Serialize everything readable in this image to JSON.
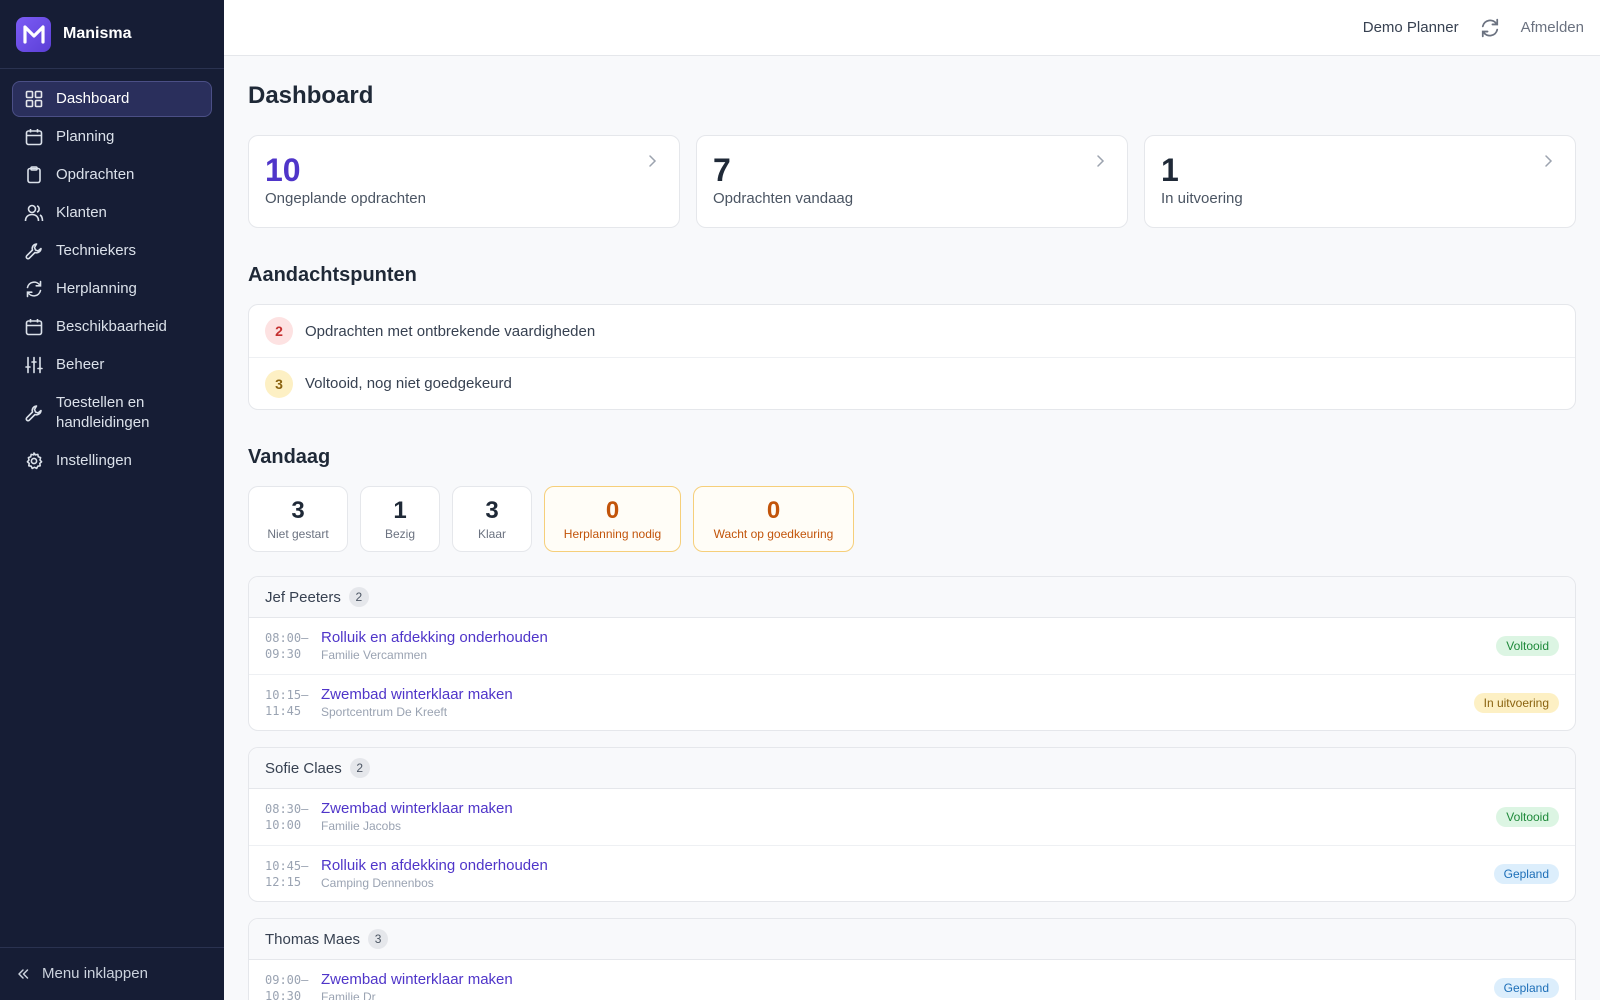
{
  "app": {
    "name": "Manisma"
  },
  "sidebar": {
    "items": [
      {
        "label": "Dashboard",
        "icon": "grid-icon",
        "active": true
      },
      {
        "label": "Planning",
        "icon": "calendar-icon"
      },
      {
        "label": "Opdrachten",
        "icon": "clipboard-icon"
      },
      {
        "label": "Klanten",
        "icon": "users-icon"
      },
      {
        "label": "Techniekers",
        "icon": "wrench-icon"
      },
      {
        "label": "Herplanning",
        "icon": "refresh-icon"
      },
      {
        "label": "Beschikbaarheid",
        "icon": "calendar-icon"
      },
      {
        "label": "Beheer",
        "icon": "sliders-icon"
      },
      {
        "label": "Toestellen en handleidingen",
        "icon": "wrench-icon"
      },
      {
        "label": "Instellingen",
        "icon": "gear-icon"
      }
    ],
    "collapse_label": "Menu inklappen"
  },
  "topbar": {
    "user": "Demo Planner",
    "logout": "Afmelden"
  },
  "page": {
    "title": "Dashboard"
  },
  "stat_cards": [
    {
      "value": "10",
      "label": "Ongeplande opdrachten"
    },
    {
      "value": "7",
      "label": "Opdrachten vandaag"
    },
    {
      "value": "1",
      "label": "In uitvoering"
    }
  ],
  "attention": {
    "title": "Aandachtspunten",
    "items": [
      {
        "count": "2",
        "label": "Opdrachten met ontbrekende vaardigheden",
        "color": "#c53030"
      },
      {
        "count": "3",
        "label": "Voltooid, nog niet goedgekeurd",
        "color": "#8a6310"
      }
    ]
  },
  "today": {
    "title": "Vandaag",
    "stats": [
      {
        "value": "3",
        "label": "Niet gestart"
      },
      {
        "value": "1",
        "label": "Bezig"
      },
      {
        "value": "3",
        "label": "Klaar"
      },
      {
        "value": "0",
        "label": "Herplanning nodig",
        "warn": true
      },
      {
        "value": "0",
        "label": "Wacht op goedkeuring",
        "warn": true
      }
    ]
  },
  "technicians": [
    {
      "name": "Jef Peeters",
      "count": "2",
      "jobs": [
        {
          "start": "08:00–",
          "end": "09:30",
          "title": "Rolluik en afdekking onderhouden",
          "client": "Familie Vercammen",
          "status": "Voltooid"
        },
        {
          "start": "10:15–",
          "end": "11:45",
          "title": "Zwembad winterklaar maken",
          "client": "Sportcentrum De Kreeft",
          "status": "In uitvoering"
        }
      ]
    },
    {
      "name": "Sofie Claes",
      "count": "2",
      "jobs": [
        {
          "start": "08:30–",
          "end": "10:00",
          "title": "Zwembad winterklaar maken",
          "client": "Familie Jacobs",
          "status": "Voltooid"
        },
        {
          "start": "10:45–",
          "end": "12:15",
          "title": "Rolluik en afdekking onderhouden",
          "client": "Camping Dennenbos",
          "status": "Gepland"
        }
      ]
    },
    {
      "name": "Thomas Maes",
      "count": "3",
      "jobs": [
        {
          "start": "09:00–",
          "end": "10:30",
          "title": "Zwembad winterklaar maken",
          "client": "Familie Dr",
          "status": "Gepland"
        }
      ]
    }
  ],
  "colors": {
    "sidebar_bg": "#161d35",
    "accent": "#4f35c9",
    "warn": "#c2540a"
  }
}
